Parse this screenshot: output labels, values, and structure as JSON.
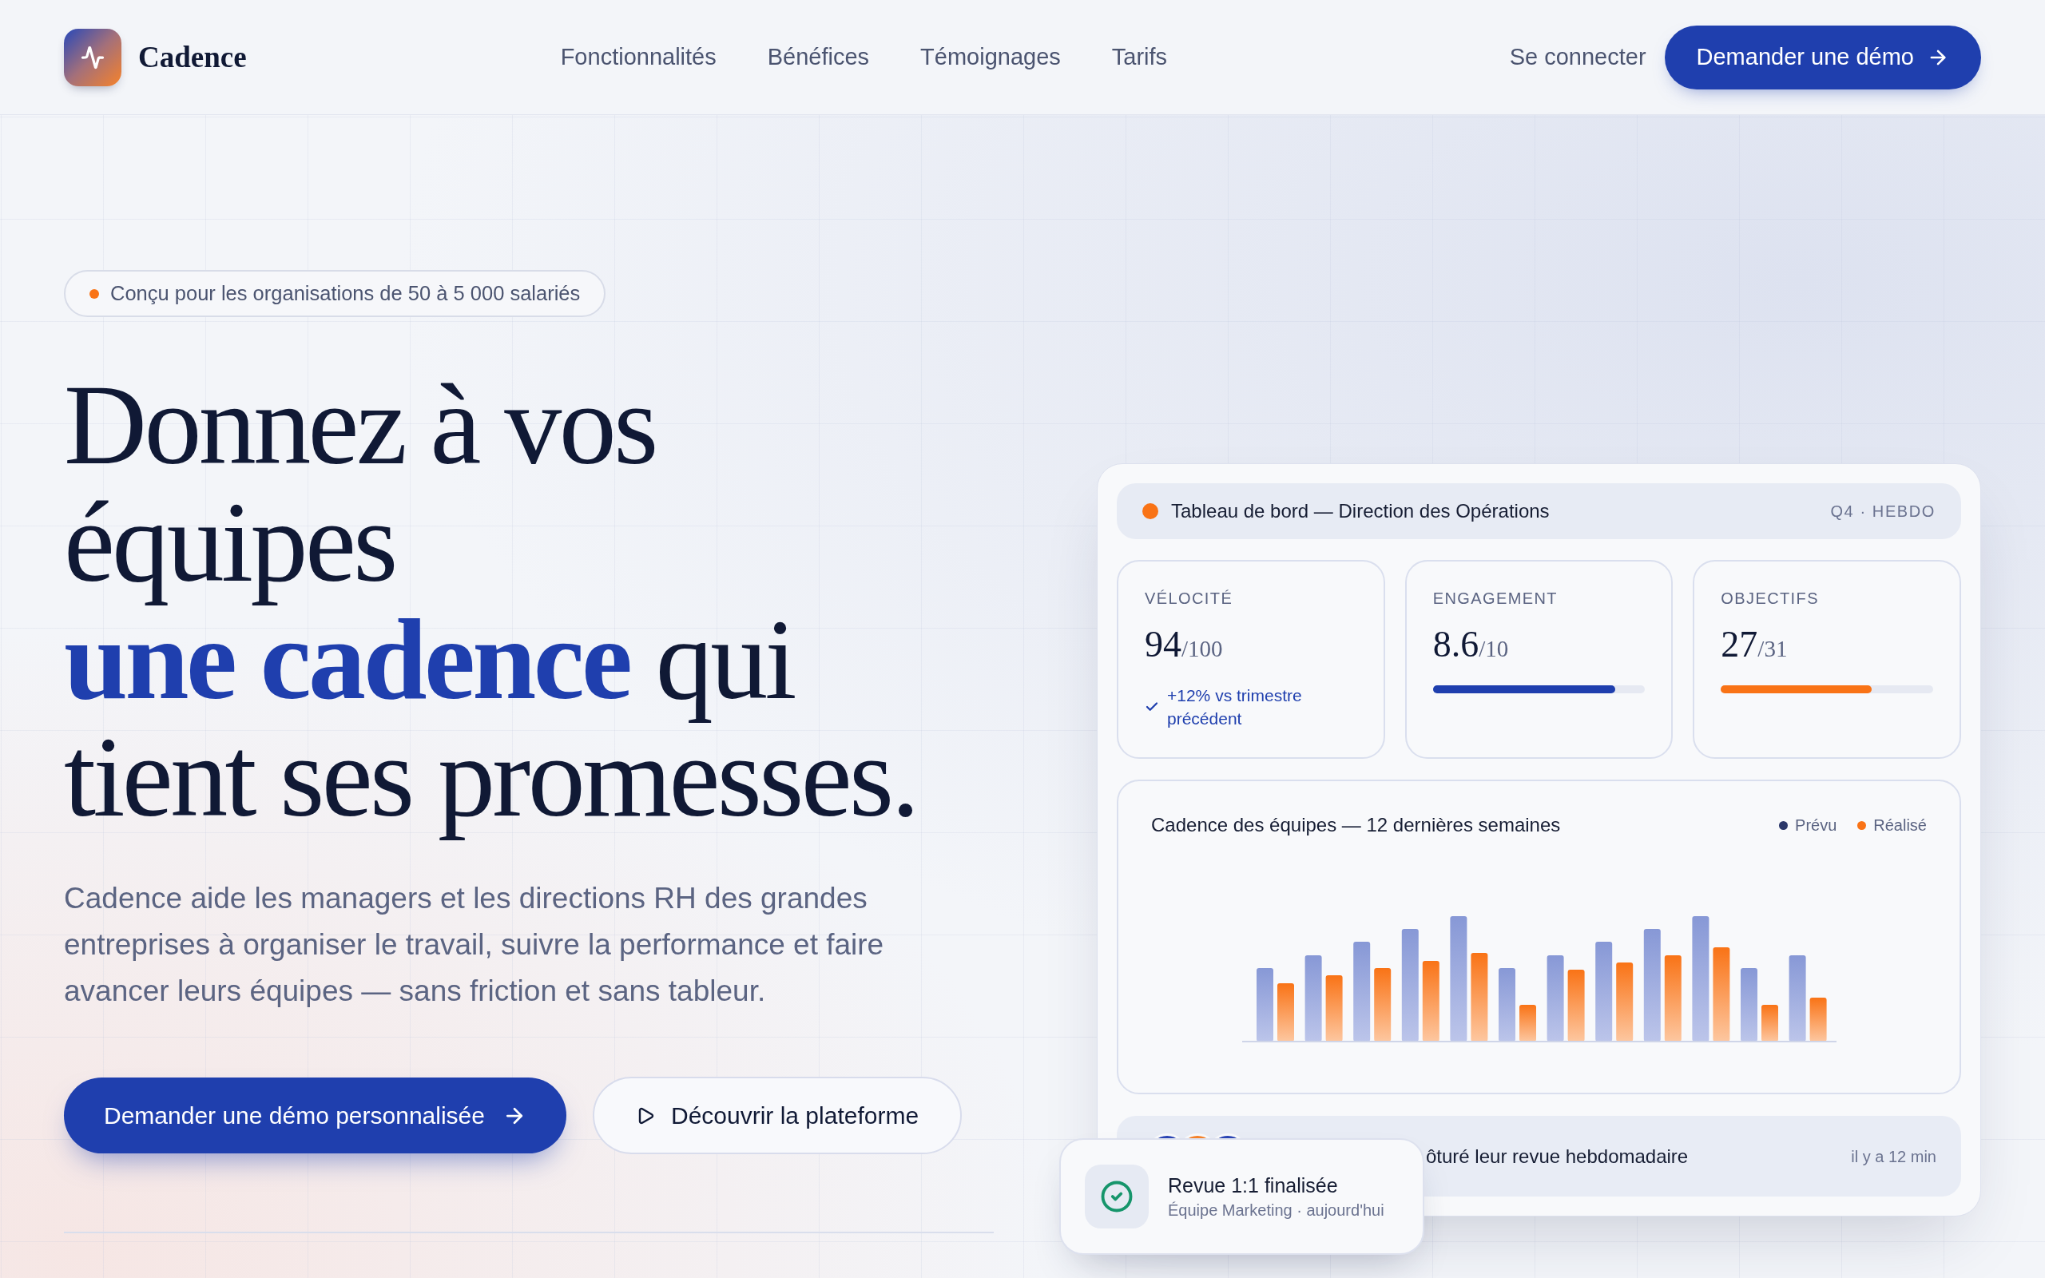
{
  "header": {
    "brand": "Cadence",
    "nav": [
      "Fonctionnalités",
      "Bénéfices",
      "Témoignages",
      "Tarifs"
    ],
    "login": "Se connecter",
    "cta": "Demander une démo"
  },
  "hero": {
    "badge": "Conçu pour les organisations de 50 à 5 000 salariés",
    "headline": [
      "Donnez à vos équipes",
      "**une cadence** qui tient ses promesses."
    ],
    "description": "Cadence aide les managers et les directions RH des grandes entreprises à organiser le travail, suivre la performance et faire avancer leurs équipes — sans friction et sans tableur.",
    "buttons": [
      {
        "kind": "primary",
        "label": "Demander une démo personnalisée"
      },
      {
        "kind": "secondary",
        "label": "Découvrir la plateforme"
      }
    ]
  },
  "dashboard": {
    "title": "Tableau de bord — Direction des Opérations",
    "period": "Q4 · HEBDO",
    "metrics": [
      {
        "kind": "trend",
        "label": "VÉLOCITÉ",
        "value": "94",
        "unit": "/100",
        "trend": "+12% vs trimestre précédent"
      },
      {
        "kind": "progress",
        "label": "ENGAGEMENT",
        "value": "8.6",
        "unit": "/10",
        "level": 0.86,
        "color": "#1f3fae"
      },
      {
        "kind": "progress",
        "label": "OBJECTIFS",
        "value": "27",
        "unit": "/31",
        "level": 0.71,
        "color": "#f97316"
      }
    ],
    "chart": {
      "title": "Cadence des équipes — 12 dernières semaines",
      "legend": [
        {
          "label": "Prévu",
          "color": "#2b3769"
        },
        {
          "label": "Réalisé",
          "color": "#f97316"
        }
      ]
    },
    "activity": {
      "text": "ôturé leur revue hebdomadaire",
      "time": "il y a 12 min"
    }
  },
  "toast": {
    "title": "Revue 1:1 finalisée",
    "subtitle": "Équipe Marketing · aujourd'hui"
  }
}
